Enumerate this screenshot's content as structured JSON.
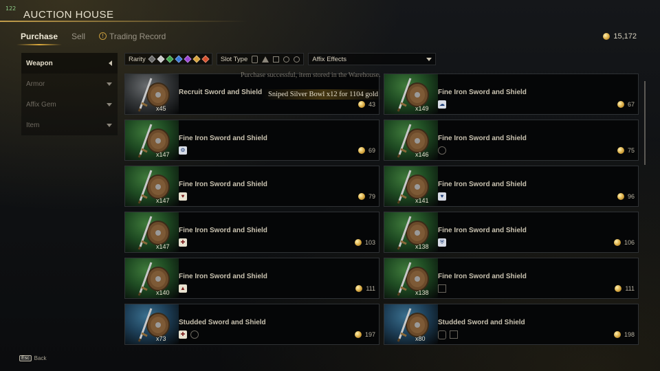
{
  "header": {
    "level_badge": "122",
    "title": "AUCTION HOUSE",
    "gold_total": "15,172"
  },
  "tabs": [
    {
      "label": "Purchase",
      "active": true
    },
    {
      "label": "Sell",
      "active": false
    },
    {
      "label": "Trading Record",
      "active": false,
      "alert_icon": "exclamation-icon"
    }
  ],
  "sidebar": {
    "items": [
      {
        "label": "Weapon",
        "active": true,
        "icon": "chevron-left-icon"
      },
      {
        "label": "Armor",
        "active": false,
        "icon": "chevron-down-icon"
      },
      {
        "label": "Affix Gem",
        "active": false,
        "icon": "chevron-down-icon"
      },
      {
        "label": "Item",
        "active": false,
        "icon": "chevron-down-icon"
      }
    ]
  },
  "filters": {
    "rarity_label": "Rarity",
    "rarity_colors": [
      "#6b6b6b",
      "#c8c8c8",
      "#3fa34d",
      "#3a78d6",
      "#9a46d6",
      "#d6a13a",
      "#d6502c"
    ],
    "slot_type_label": "Slot Type",
    "slot_shapes": [
      "rounded",
      "tri",
      "square",
      "circle",
      "circle"
    ],
    "affix_label": "Affix Effects"
  },
  "notifications": {
    "purchase": "Purchase successful, item stored in the Warehouse.",
    "sniped": "Sniped Silver Bowl x12 for 1104 gold"
  },
  "listings": [
    {
      "name": "Recruit Sword and Shield",
      "qty": "x45",
      "price": "43",
      "bg": "grey",
      "affixes": []
    },
    {
      "name": "Fine Iron Sword and Shield",
      "qty": "x149",
      "price": "67",
      "bg": "green",
      "affixes": [
        {
          "type": "blue",
          "glyph": "☁"
        }
      ]
    },
    {
      "name": "Fine Iron Sword and Shield",
      "qty": "x147",
      "price": "69",
      "bg": "green",
      "affixes": [
        {
          "type": "blue",
          "glyph": "⚙"
        }
      ]
    },
    {
      "name": "Fine Iron Sword and Shield",
      "qty": "x146",
      "price": "75",
      "bg": "green",
      "affixes": [
        {
          "type": "empty-c",
          "glyph": ""
        }
      ]
    },
    {
      "name": "Fine Iron Sword and Shield",
      "qty": "x147",
      "price": "79",
      "bg": "green",
      "affixes": [
        {
          "type": "filled",
          "glyph": "♥"
        }
      ]
    },
    {
      "name": "Fine Iron Sword and Shield",
      "qty": "x141",
      "price": "96",
      "bg": "green",
      "affixes": [
        {
          "type": "blue",
          "glyph": "♥"
        }
      ]
    },
    {
      "name": "Fine Iron Sword and Shield",
      "qty": "x147",
      "price": "103",
      "bg": "green",
      "affixes": [
        {
          "type": "filled",
          "glyph": "✚"
        }
      ]
    },
    {
      "name": "Fine Iron Sword and Shield",
      "qty": "x138",
      "price": "106",
      "bg": "green",
      "affixes": [
        {
          "type": "blue",
          "glyph": "⛨"
        }
      ]
    },
    {
      "name": "Fine Iron Sword and Shield",
      "qty": "x140",
      "price": "111",
      "bg": "green",
      "affixes": [
        {
          "type": "filled",
          "glyph": "▲"
        }
      ]
    },
    {
      "name": "Fine Iron Sword and Shield",
      "qty": "x138",
      "price": "111",
      "bg": "green",
      "affixes": [
        {
          "type": "empty-s",
          "glyph": ""
        }
      ]
    },
    {
      "name": "Studded Sword and Shield",
      "qty": "x73",
      "price": "197",
      "bg": "blue",
      "affixes": [
        {
          "type": "filled",
          "glyph": "✚"
        },
        {
          "type": "empty-c",
          "glyph": ""
        }
      ]
    },
    {
      "name": "Studded Sword and Shield",
      "qty": "x80",
      "price": "198",
      "bg": "blue",
      "affixes": [
        {
          "type": "empty-r",
          "glyph": ""
        },
        {
          "type": "empty-s",
          "glyph": ""
        }
      ]
    }
  ],
  "footer": {
    "key": "Esc",
    "label": "Back"
  }
}
